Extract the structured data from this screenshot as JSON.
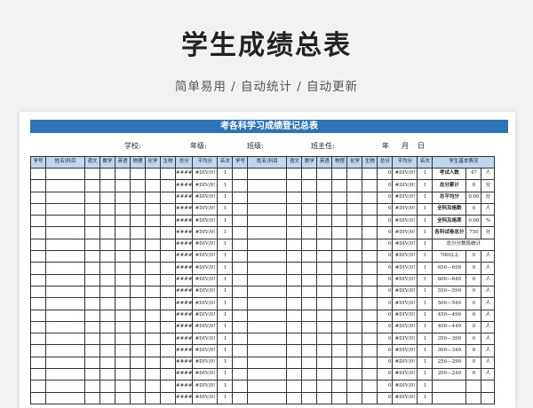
{
  "hero": {
    "title": "学生成绩总表",
    "subtitle": "简单易用  /  自动统计  /  自动更新"
  },
  "sheet": {
    "banner": "考各科学习成绩登记总表",
    "info": {
      "school": "学校:",
      "grade": "年级:",
      "class": "班级:",
      "teacher": "班主任:",
      "year": "年",
      "month": "月",
      "day": "日"
    },
    "headers_left": [
      "学号",
      "姓名\\科目",
      "语文",
      "数学",
      "英语",
      "物理",
      "化学",
      "生物",
      "总分",
      "平均分",
      "名次"
    ],
    "headers_right": [
      "学号",
      "姓名\\科目",
      "语文",
      "数学",
      "英语",
      "物理",
      "化学",
      "生物",
      "总分",
      "平均分",
      "名次"
    ],
    "stats_header": "学生基本情况",
    "left_row": {
      "total": "####",
      "avg": "#DIV/0!",
      "rank": "1"
    },
    "right_row": {
      "total": "0",
      "avg": "#DIV/0!",
      "rank": "1"
    },
    "row_count": 20,
    "basic_stats": [
      {
        "label": "考试人数",
        "value": "47",
        "unit": "人"
      },
      {
        "label": "总分累计",
        "value": "0",
        "unit": "分"
      },
      {
        "label": "总平均分",
        "value": "0.00",
        "unit": "分"
      },
      {
        "label": "全科及格数",
        "value": "0",
        "unit": "人"
      },
      {
        "label": "全科及格率",
        "value": "0.00",
        "unit": "%"
      },
      {
        "label": "各科试卷总分",
        "value": "750",
        "unit": "分"
      }
    ],
    "segment_title": "总分分数段统计",
    "segments": [
      {
        "range": "700以上",
        "count": "0",
        "unit": "人"
      },
      {
        "range": "650—699",
        "count": "0",
        "unit": "人"
      },
      {
        "range": "600—649",
        "count": "0",
        "unit": "人"
      },
      {
        "range": "550—599",
        "count": "0",
        "unit": "人"
      },
      {
        "range": "500—549",
        "count": "0",
        "unit": "人"
      },
      {
        "range": "450—499",
        "count": "0",
        "unit": "人"
      },
      {
        "range": "400—449",
        "count": "0",
        "unit": "人"
      },
      {
        "range": "350—399",
        "count": "0",
        "unit": "人"
      },
      {
        "range": "300—349",
        "count": "0",
        "unit": "人"
      },
      {
        "range": "250—299",
        "count": "0",
        "unit": "人"
      },
      {
        "range": "200—249",
        "count": "0",
        "unit": "人"
      }
    ],
    "colors": {
      "banner": "#2e74b5",
      "header_fill": "#bdd7ee"
    }
  }
}
